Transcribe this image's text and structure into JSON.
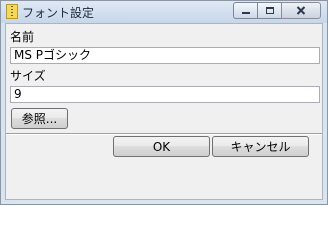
{
  "window": {
    "title": "フォント設定"
  },
  "caption_buttons": {
    "minimize": "minimize-icon",
    "maximize": "maximize-icon",
    "close": "close-icon"
  },
  "form": {
    "name_label": "名前",
    "name_value": "MS Pゴシック",
    "size_label": "サイズ",
    "size_value": "9",
    "browse_button": "参照..."
  },
  "footer": {
    "ok_button": "OK",
    "cancel_button": "キャンセル"
  },
  "colors": {
    "titlebar": "#c7d6e9",
    "client_bg": "#f0f0f0",
    "close_hover": "#c75050"
  }
}
